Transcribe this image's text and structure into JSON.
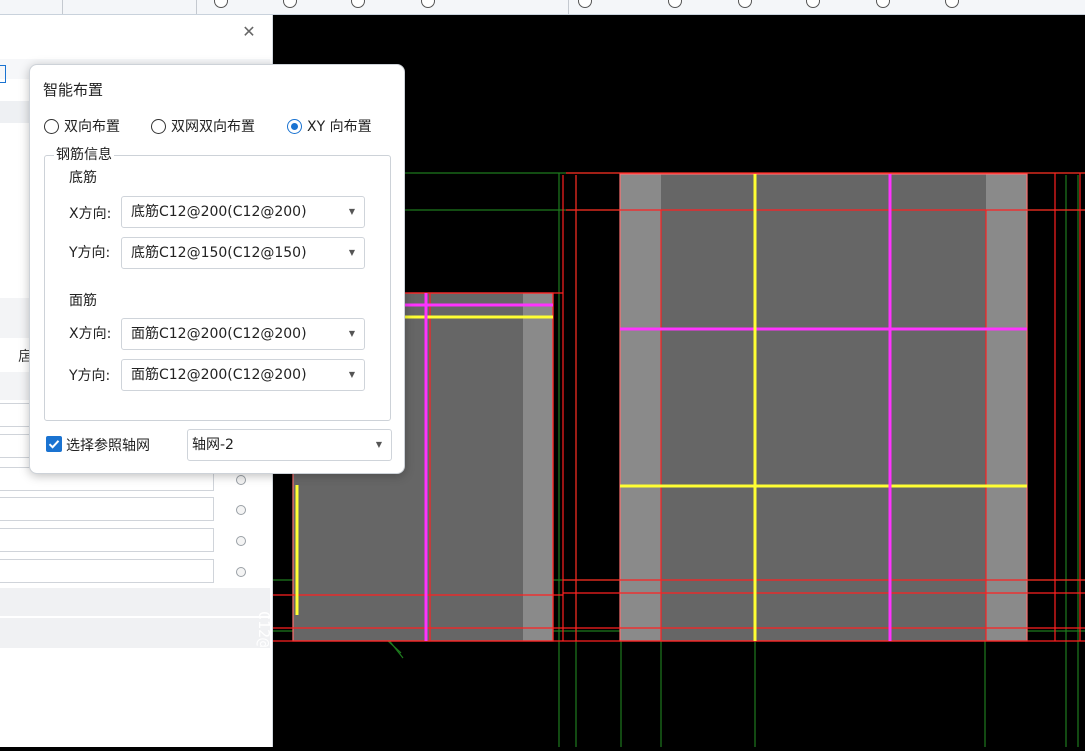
{
  "dialog": {
    "title": "智能布置",
    "modes": [
      {
        "label": "双向布置",
        "checked": false
      },
      {
        "label": "双网双向布置",
        "checked": false
      },
      {
        "label": "XY 向布置",
        "checked": true
      }
    ],
    "group_title": "钢筋信息",
    "bottom": {
      "title": "底筋",
      "x_label": "X方向:",
      "x_value": "底筋C12@200(C12@200)",
      "y_label": "Y方向:",
      "y_value": "底筋C12@150(C12@150)"
    },
    "top": {
      "title": "面筋",
      "x_label": "X方向:",
      "x_value": "面筋C12@200(C12@200)",
      "y_label": "Y方向:",
      "y_value": "面筋C12@200(C12@200)"
    },
    "ref_grid": {
      "label": "选择参照轴网",
      "checked": true,
      "value": "轴网-2"
    }
  },
  "panel": {
    "close_icon": "close-icon",
    "partial_label": "扂"
  },
  "canvas": {
    "rebar_text": "C12@200"
  },
  "colors": {
    "accent": "#1a73d1",
    "canvas_bg": "#000000",
    "slab_fill": "#666666",
    "slab_edge": "#8a8a8a",
    "rebar_magenta": "#ff33ff",
    "rebar_yellow": "#ffff33",
    "line_red": "#ff2020",
    "line_green": "#1e7a1e"
  }
}
